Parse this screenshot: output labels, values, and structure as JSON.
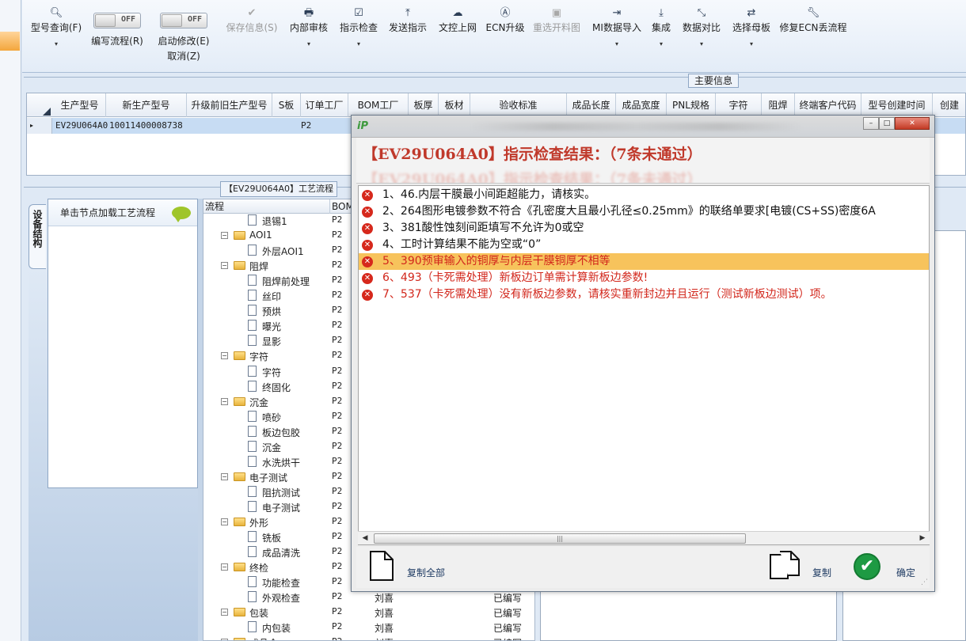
{
  "toolbar": {
    "model_query": "型号查询(F)",
    "edit_flow": "编写流程(R)",
    "edit_flow_toggle": "OFF",
    "start_modify": "启动修改(E)",
    "start_modify_cancel": "取消(Z)",
    "start_modify_toggle": "OFF",
    "save_info": "保存信息(S)",
    "internal_review": "内部审核",
    "indicator_check": "指示检查",
    "send_instruction": "发送指示",
    "upload_online": "文控上网",
    "ecn_upgrade": "ECN升级",
    "reselect_material": "重选开料图",
    "mi_import": "MI数据导入",
    "integrate": "集成",
    "data_compare": "数据对比",
    "select_mother_board": "选择母板",
    "repair_ecn": "修复ECN丢流程",
    "dropdown_glyph": "▾"
  },
  "main_info": {
    "section_label": "主要信息",
    "columns": [
      "生产型号",
      "新生产型号",
      "升级前旧生产型号",
      "S板",
      "订单工厂",
      "BOM工厂",
      "板厚",
      "板材",
      "验收标准",
      "成品长度",
      "成品宽度",
      "PNL规格",
      "字符",
      "阻焊",
      "终端客户代码",
      "型号创建时间",
      "创建"
    ],
    "row": {
      "marker": "▸",
      "model": "EV29U064A0",
      "new_model": "10011400008738",
      "order_factory": "P2"
    }
  },
  "process": {
    "section_label": "【EV29U064A0】工艺流程",
    "vtab_label": "设备结构",
    "node_hint": "单击节点加载工艺流程",
    "columns": [
      "流程",
      "BOM工"
    ],
    "rows": [
      {
        "name": "退锡1",
        "level": 2,
        "bom": "P2",
        "who": "",
        "status": ""
      },
      {
        "name": "AOI1",
        "level": 1,
        "bom": "P2",
        "who": "",
        "status": ""
      },
      {
        "name": "外层AOI1",
        "level": 2,
        "bom": "P2",
        "who": "",
        "status": ""
      },
      {
        "name": "阻焊",
        "level": 1,
        "bom": "P2",
        "who": "",
        "status": ""
      },
      {
        "name": "阻焊前处理",
        "level": 2,
        "bom": "P2",
        "who": "",
        "status": ""
      },
      {
        "name": "丝印",
        "level": 2,
        "bom": "P2",
        "who": "",
        "status": ""
      },
      {
        "name": "预烘",
        "level": 2,
        "bom": "P2",
        "who": "",
        "status": ""
      },
      {
        "name": "曝光",
        "level": 2,
        "bom": "P2",
        "who": "",
        "status": ""
      },
      {
        "name": "显影",
        "level": 2,
        "bom": "P2",
        "who": "",
        "status": ""
      },
      {
        "name": "字符",
        "level": 1,
        "bom": "P2",
        "who": "",
        "status": ""
      },
      {
        "name": "字符",
        "level": 2,
        "bom": "P2",
        "who": "",
        "status": ""
      },
      {
        "name": "终固化",
        "level": 2,
        "bom": "P2",
        "who": "",
        "status": ""
      },
      {
        "name": "沉金",
        "level": 1,
        "bom": "P2",
        "who": "",
        "status": ""
      },
      {
        "name": "喷砂",
        "level": 2,
        "bom": "P2",
        "who": "",
        "status": ""
      },
      {
        "name": "板边包胶",
        "level": 2,
        "bom": "P2",
        "who": "",
        "status": ""
      },
      {
        "name": "沉金",
        "level": 2,
        "bom": "P2",
        "who": "",
        "status": ""
      },
      {
        "name": "水洗烘干",
        "level": 2,
        "bom": "P2",
        "who": "",
        "status": ""
      },
      {
        "name": "电子测试",
        "level": 1,
        "bom": "P2",
        "who": "",
        "status": ""
      },
      {
        "name": "阻抗测试",
        "level": 2,
        "bom": "P2",
        "who": "",
        "status": ""
      },
      {
        "name": "电子测试",
        "level": 2,
        "bom": "P2",
        "who": "",
        "status": ""
      },
      {
        "name": "外形",
        "level": 1,
        "bom": "P2",
        "who": "",
        "status": ""
      },
      {
        "name": "铣板",
        "level": 2,
        "bom": "P2",
        "who": "",
        "status": ""
      },
      {
        "name": "成品清洗",
        "level": 2,
        "bom": "P2",
        "who": "",
        "status": ""
      },
      {
        "name": "终检",
        "level": 1,
        "bom": "P2",
        "who": "",
        "status": ""
      },
      {
        "name": "功能检查",
        "level": 2,
        "bom": "P2",
        "who": "",
        "status": ""
      },
      {
        "name": "外观检查",
        "level": 2,
        "bom": "P2",
        "who": "刘喜",
        "status": "已编写"
      },
      {
        "name": "包装",
        "level": 1,
        "bom": "P2",
        "who": "刘喜",
        "status": "已编写"
      },
      {
        "name": "内包装",
        "level": 2,
        "bom": "P2",
        "who": "刘喜",
        "status": "已编写"
      },
      {
        "name": "成品仓",
        "level": 1,
        "bom": "P2",
        "who": "刘喜",
        "status": "已编写"
      }
    ]
  },
  "dialog": {
    "logo": "iP",
    "title": "【EV29U064A0】指示检查结果：（7条未通过）",
    "min_glyph": "–",
    "max_glyph": "□",
    "close_glyph": "✕",
    "items": [
      {
        "text": "1、46.内层干膜最小间距超能力，请核实。",
        "color": "black",
        "selected": false
      },
      {
        "text": "2、264图形电镀参数不符合《孔密度大且最小孔径≤0.25mm》的联络单要求[电镀(CS+SS)密度6A",
        "color": "black",
        "selected": false
      },
      {
        "text": "3、381酸性蚀刻间距填写不允许为0或空",
        "color": "black",
        "selected": false
      },
      {
        "text": "4、工时计算结果不能为空或“0”",
        "color": "black",
        "selected": false
      },
      {
        "text": "5、390预审输入的铜厚与内层干膜铜厚不相等",
        "color": "red",
        "selected": true
      },
      {
        "text": "6、493（卡死需处理）新板边订单需计算新板边参数!",
        "color": "red",
        "selected": false
      },
      {
        "text": "7、537（卡死需处理）没有新板边参数，请核实重新封边并且运行（测试新板边测试）项。",
        "color": "red",
        "selected": false
      }
    ],
    "scroll_left": "◀",
    "scroll_right": "▶",
    "scroll_grip": "|||",
    "copy_all": "复制全部",
    "copy": "复制",
    "ok": "确定",
    "ok_glyph": "✔"
  }
}
